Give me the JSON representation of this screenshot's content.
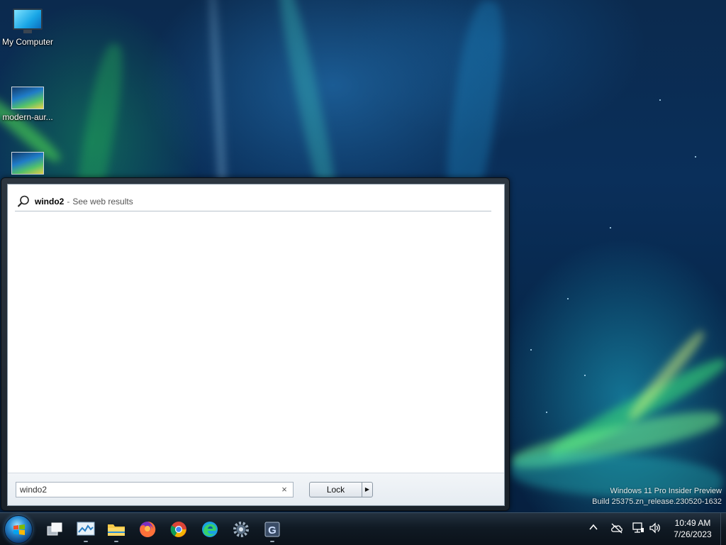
{
  "desktop": {
    "icons": [
      {
        "label": "My Computer",
        "icon": "computer-icon"
      },
      {
        "label": "modern-aur...",
        "icon": "image-file-icon"
      },
      {
        "label": "",
        "icon": "image-file-icon"
      }
    ],
    "watermark": {
      "line1": "Windows 11 Pro Insider Preview",
      "line2": "Build 25375.zn_release.230520-1632"
    }
  },
  "start_menu": {
    "search_result": {
      "query": "windo2",
      "separator": "-",
      "label": "See web results",
      "icon": "search-icon"
    },
    "search_box": {
      "value": "windo2",
      "clear_icon": "×"
    },
    "power": {
      "label": "Lock",
      "arrow": "▶"
    }
  },
  "taskbar": {
    "start_button": "windows-start-orb",
    "apps": [
      {
        "name": "task-view",
        "running": false
      },
      {
        "name": "task-manager",
        "running": true
      },
      {
        "name": "file-explorer",
        "running": true
      },
      {
        "name": "firefox",
        "running": false
      },
      {
        "name": "chrome",
        "running": false
      },
      {
        "name": "edge",
        "running": false
      },
      {
        "name": "settings",
        "running": false
      },
      {
        "name": "gitk-app",
        "running": true
      }
    ],
    "tray": {
      "overflow_icon": "^",
      "clock_time": "10:49 AM",
      "clock_date": "7/26/2023"
    }
  },
  "colors": {
    "taskbar_bg": "#101a24",
    "menu_frame": "#2c3640",
    "accent": "#2b8fd6"
  }
}
